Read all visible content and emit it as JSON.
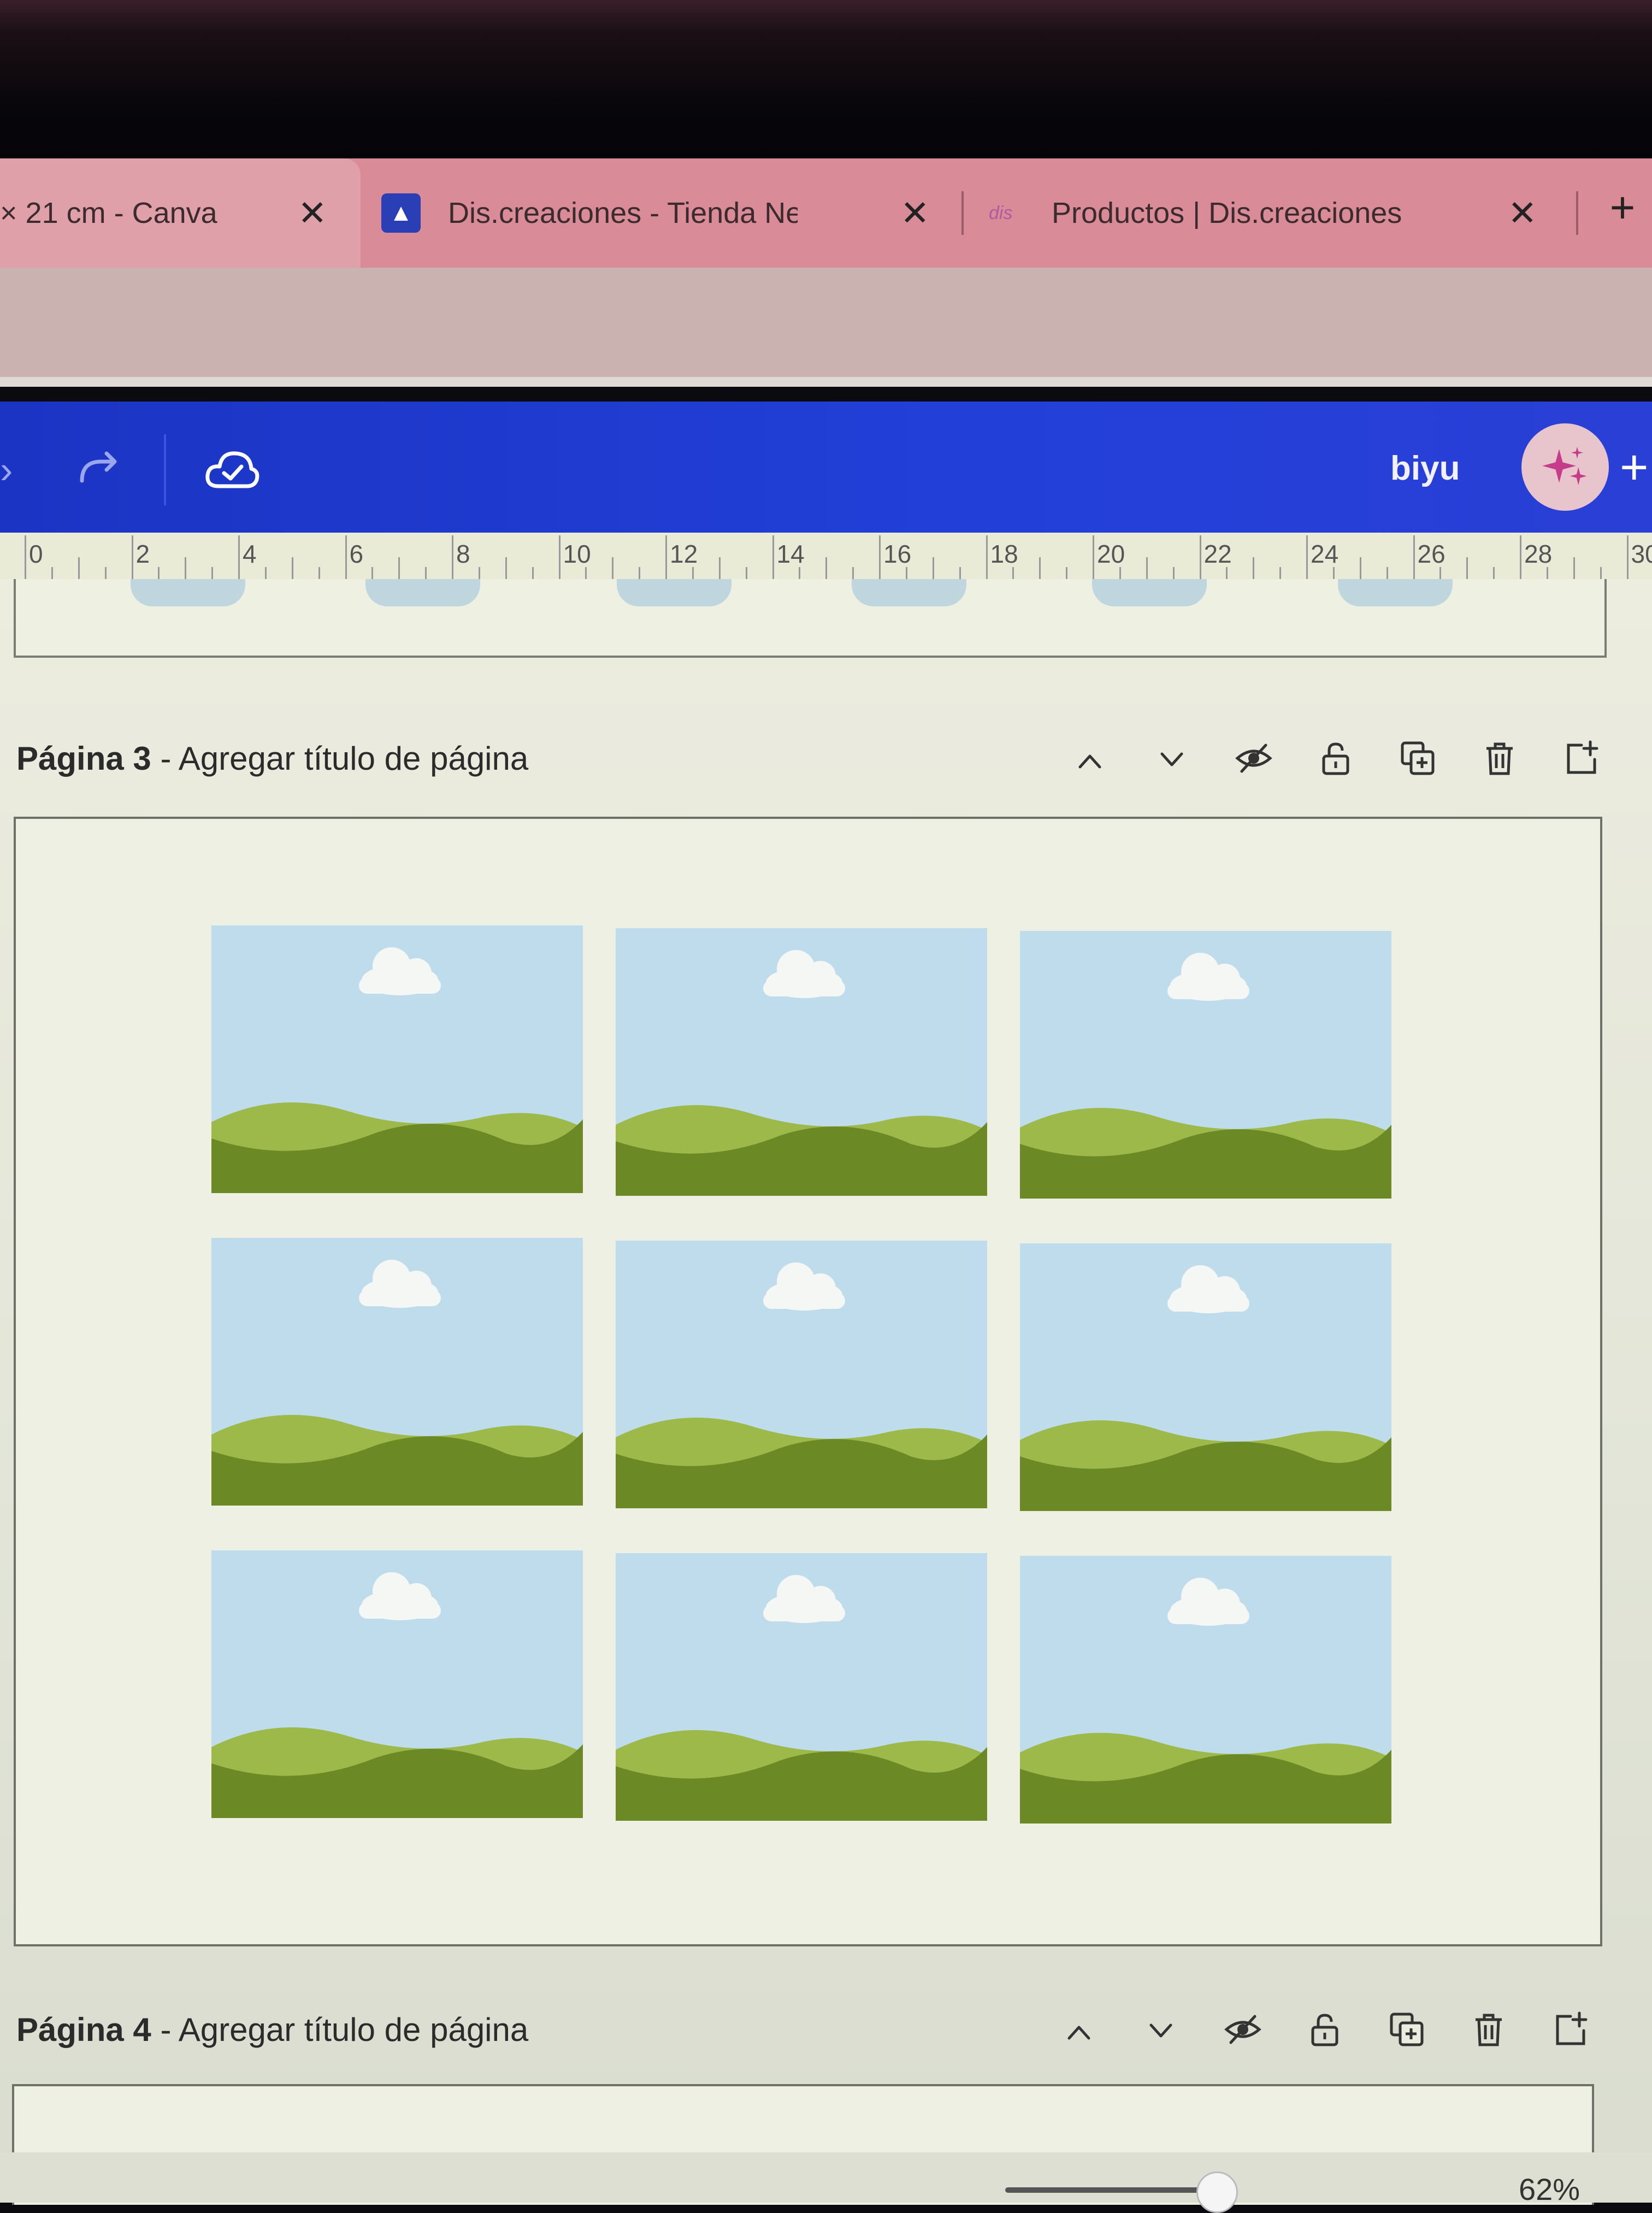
{
  "browser": {
    "tabs": [
      {
        "title": "× 21 cm - Canva",
        "close": "✕"
      },
      {
        "title": "Dis.creaciones - Tienda Negocio",
        "close": "✕"
      },
      {
        "title": "Productos | Dis.creaciones",
        "close": "✕",
        "favicon_text": "dis"
      }
    ],
    "new_tab": "+"
  },
  "header": {
    "user_name": "biyu",
    "plus": "+",
    "accent": "#2240d8"
  },
  "ruler": {
    "labels": [
      "0",
      "2",
      "4",
      "6",
      "8",
      "10",
      "12",
      "14",
      "16",
      "18",
      "20",
      "22",
      "24",
      "26",
      "28",
      "30"
    ]
  },
  "pages": [
    {
      "number_label": "Página 3",
      "title_placeholder": " - Agregar título de página"
    },
    {
      "number_label": "Página 4",
      "title_placeholder": " - Agregar título de página"
    }
  ],
  "page_actions": [
    "chevron-up-icon",
    "chevron-down-icon",
    "hide-icon",
    "lock-icon",
    "duplicate-icon",
    "trash-icon",
    "add-page-icon"
  ],
  "design": {
    "tiles_rows": 3,
    "tiles_cols": 3,
    "sky_color": "#bfdcec",
    "hill_light": "#9db94a",
    "hill_dark": "#6b8a26"
  },
  "zoom": {
    "value": "62%"
  }
}
